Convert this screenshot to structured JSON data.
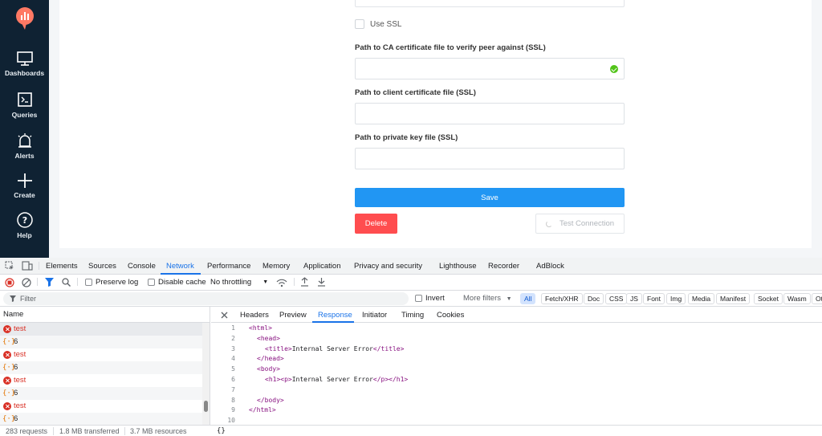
{
  "sidebar": {
    "items": [
      {
        "label": "Dashboards",
        "icon": "monitor-icon"
      },
      {
        "label": "Queries",
        "icon": "terminal-icon"
      },
      {
        "label": "Alerts",
        "icon": "bell-icon"
      },
      {
        "label": "Create",
        "icon": "plus-icon"
      },
      {
        "label": "Help",
        "icon": "help-icon"
      }
    ]
  },
  "form": {
    "use_ssl_label": "Use SSL",
    "ca_label": "Path to CA certificate file to verify peer against (SSL)",
    "client_cert_label": "Path to client certificate file (SSL)",
    "private_key_label": "Path to private key file (SSL)",
    "ca_value": "",
    "client_cert_value": "",
    "private_key_value": "",
    "save_label": "Save",
    "delete_label": "Delete",
    "test_label": "Test Connection"
  },
  "devtools": {
    "tabs": [
      "Elements",
      "Sources",
      "Console",
      "Network",
      "Performance",
      "Memory",
      "Application",
      "Privacy and security",
      "Lighthouse",
      "Recorder",
      "AdBlock"
    ],
    "active_tab": "Network",
    "toolbar": {
      "preserve_log": "Preserve log",
      "disable_cache": "Disable cache",
      "throttling": "No throttling"
    },
    "filter": {
      "placeholder": "Filter",
      "invert": "Invert",
      "more_filters": "More filters",
      "types": [
        "All",
        "Fetch/XHR",
        "Doc",
        "CSS",
        "JS",
        "Font",
        "Img",
        "Media",
        "Manifest",
        "Socket",
        "Wasm",
        "Ot"
      ]
    },
    "requests": {
      "header": "Name",
      "rows": [
        {
          "name": "test",
          "kind": "error"
        },
        {
          "name": "6",
          "kind": "xhr"
        },
        {
          "name": "test",
          "kind": "error"
        },
        {
          "name": "6",
          "kind": "xhr"
        },
        {
          "name": "test",
          "kind": "error"
        },
        {
          "name": "6",
          "kind": "xhr"
        },
        {
          "name": "test",
          "kind": "error"
        },
        {
          "name": "6",
          "kind": "xhr"
        }
      ]
    },
    "detail_tabs": [
      "Headers",
      "Preview",
      "Response",
      "Initiator",
      "Timing",
      "Cookies"
    ],
    "active_detail_tab": "Response",
    "response_lines": [
      {
        "n": "1",
        "indent": 0,
        "pre": "<html>",
        "text": "",
        "post": ""
      },
      {
        "n": "2",
        "indent": 1,
        "pre": "<head>",
        "text": "",
        "post": ""
      },
      {
        "n": "3",
        "indent": 2,
        "pre": "<title>",
        "text": "Internal Server Error",
        "post": "</title>"
      },
      {
        "n": "4",
        "indent": 1,
        "pre": "</head>",
        "text": "",
        "post": ""
      },
      {
        "n": "5",
        "indent": 1,
        "pre": "<body>",
        "text": "",
        "post": ""
      },
      {
        "n": "6",
        "indent": 2,
        "pre": "<h1><p>",
        "text": "Internal Server Error",
        "post": "</p></h1>"
      },
      {
        "n": "7",
        "indent": 0,
        "pre": "",
        "text": "",
        "post": ""
      },
      {
        "n": "8",
        "indent": 1,
        "pre": "</body>",
        "text": "",
        "post": ""
      },
      {
        "n": "9",
        "indent": 0,
        "pre": "</html>",
        "text": "",
        "post": ""
      },
      {
        "n": "10",
        "indent": 0,
        "pre": "",
        "text": "",
        "post": ""
      }
    ],
    "status": {
      "requests": "283 requests",
      "transferred": "1.8 MB transferred",
      "resources": "3.7 MB resources",
      "format": "{}"
    }
  }
}
